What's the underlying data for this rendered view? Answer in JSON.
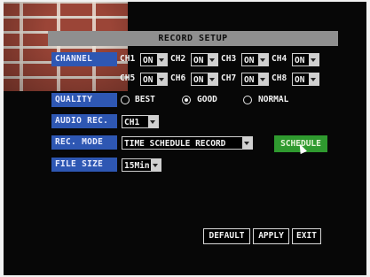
{
  "title": "RECORD SETUP",
  "channel": {
    "label": "CHANNEL",
    "items": [
      {
        "name": "CH1",
        "value": "ON"
      },
      {
        "name": "CH2",
        "value": "ON"
      },
      {
        "name": "CH3",
        "value": "ON"
      },
      {
        "name": "CH4",
        "value": "ON"
      },
      {
        "name": "CH5",
        "value": "ON"
      },
      {
        "name": "CH6",
        "value": "ON"
      },
      {
        "name": "CH7",
        "value": "ON"
      },
      {
        "name": "CH8",
        "value": "ON"
      }
    ]
  },
  "quality": {
    "label": "QUALITY",
    "options": [
      "BEST",
      "GOOD",
      "NORMAL"
    ],
    "selected": "GOOD"
  },
  "audio_rec": {
    "label": "AUDIO REC.",
    "value": "CH1"
  },
  "rec_mode": {
    "label": "REC. MODE",
    "value": "TIME SCHEDULE RECORD"
  },
  "schedule_button": "SCHEDULE",
  "file_size": {
    "label": "FILE SIZE",
    "value": "15Min"
  },
  "buttons": {
    "default": "DEFAULT",
    "apply": "APPLY",
    "exit": "EXIT"
  },
  "colors": {
    "label_bg": "#2e57b3",
    "title_bg": "#8f8f8f",
    "schedule_bg": "#2f9a2f",
    "screen_bg": "#070707"
  }
}
